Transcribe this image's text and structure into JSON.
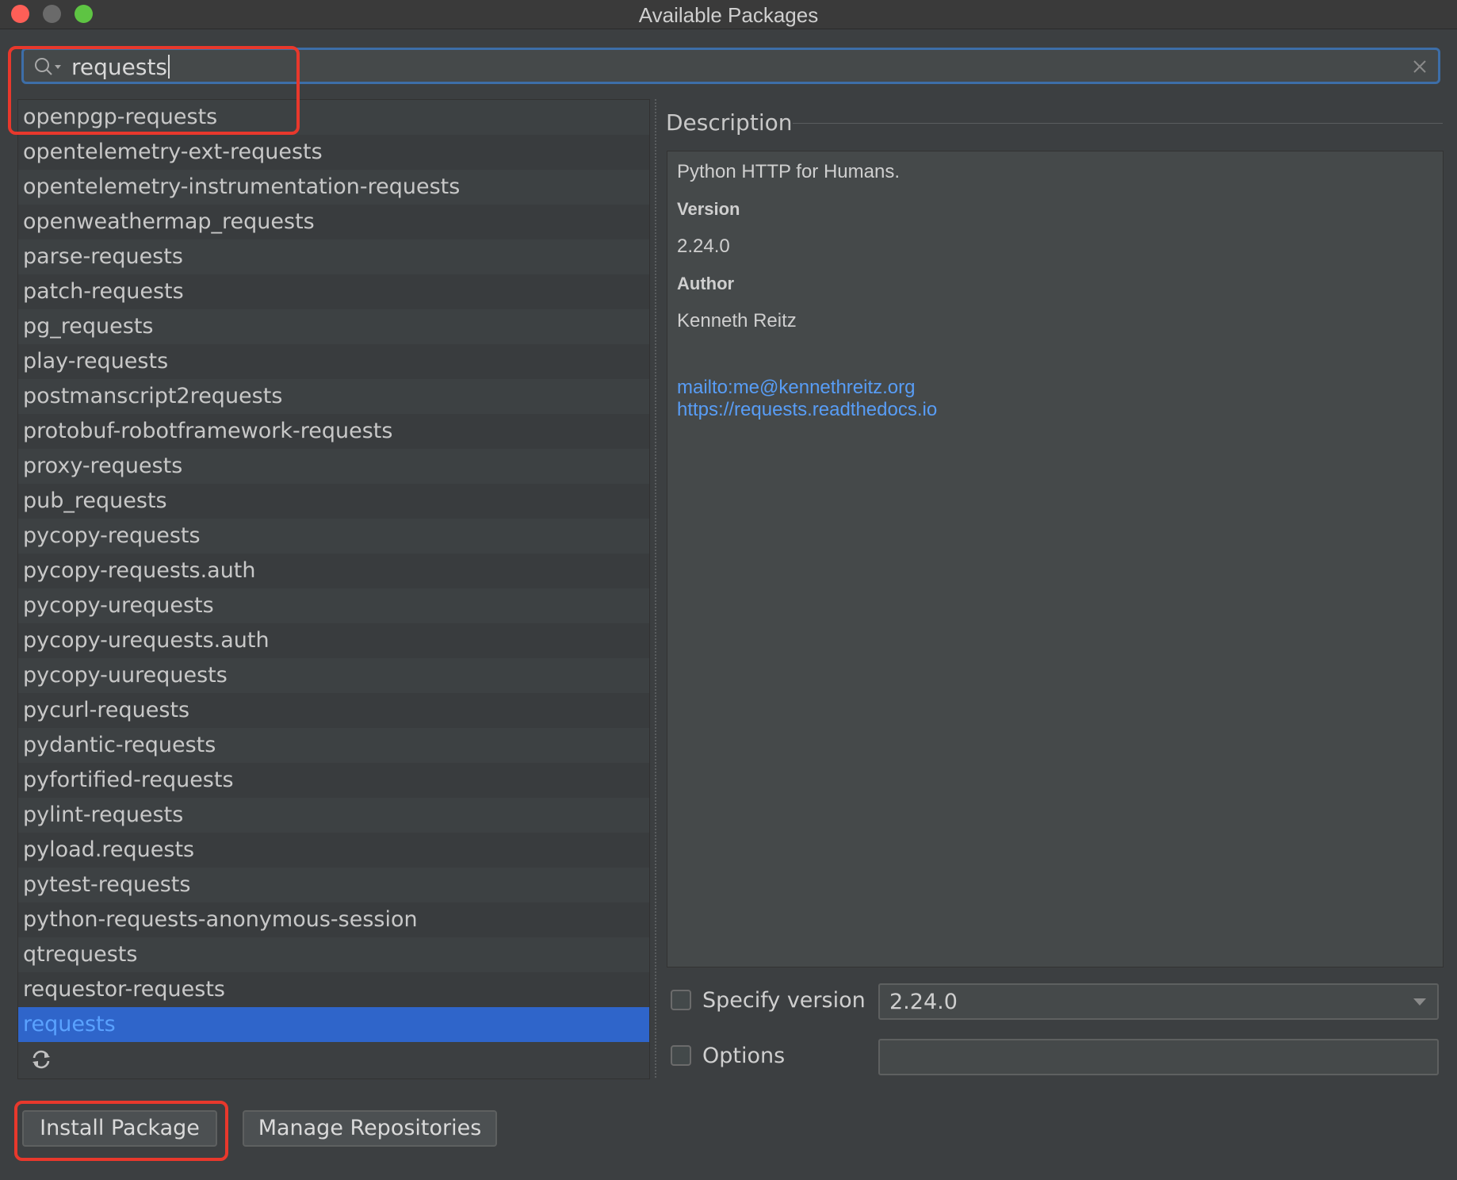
{
  "window": {
    "title": "Available Packages"
  },
  "search": {
    "value": "requests"
  },
  "packages": [
    "openpgp-requests",
    "opentelemetry-ext-requests",
    "opentelemetry-instrumentation-requests",
    "openweathermap_requests",
    "parse-requests",
    "patch-requests",
    "pg_requests",
    "play-requests",
    "postmanscript2requests",
    "protobuf-robotframework-requests",
    "proxy-requests",
    "pub_requests",
    "pycopy-requests",
    "pycopy-requests.auth",
    "pycopy-urequests",
    "pycopy-urequests.auth",
    "pycopy-uurequests",
    "pycurl-requests",
    "pydantic-requests",
    "pyfortified-requests",
    "pylint-requests",
    "pyload.requests",
    "pytest-requests",
    "python-requests-anonymous-session",
    "qtrequests",
    "requestor-requests",
    "requests"
  ],
  "selected_package": "requests",
  "description": {
    "heading": "Description",
    "summary": "Python HTTP for Humans.",
    "version_label": "Version",
    "version": "2.24.0",
    "author_label": "Author",
    "author": "Kenneth Reitz",
    "email_link": "mailto:me@kennethreitz.org",
    "home_link": "https://requests.readthedocs.io"
  },
  "options": {
    "specify_version_label": "Specify version",
    "specify_version_checked": false,
    "version_value": "2.24.0",
    "options_label": "Options",
    "options_checked": false,
    "options_value": ""
  },
  "buttons": {
    "install": "Install Package",
    "manage": "Manage Repositories"
  },
  "colors": {
    "accent": "#2f65ca",
    "link": "#589df6",
    "annotation": "#e8382c"
  },
  "icons": [
    "search-icon",
    "clear-icon",
    "refresh-icon",
    "chevron-down-icon"
  ]
}
